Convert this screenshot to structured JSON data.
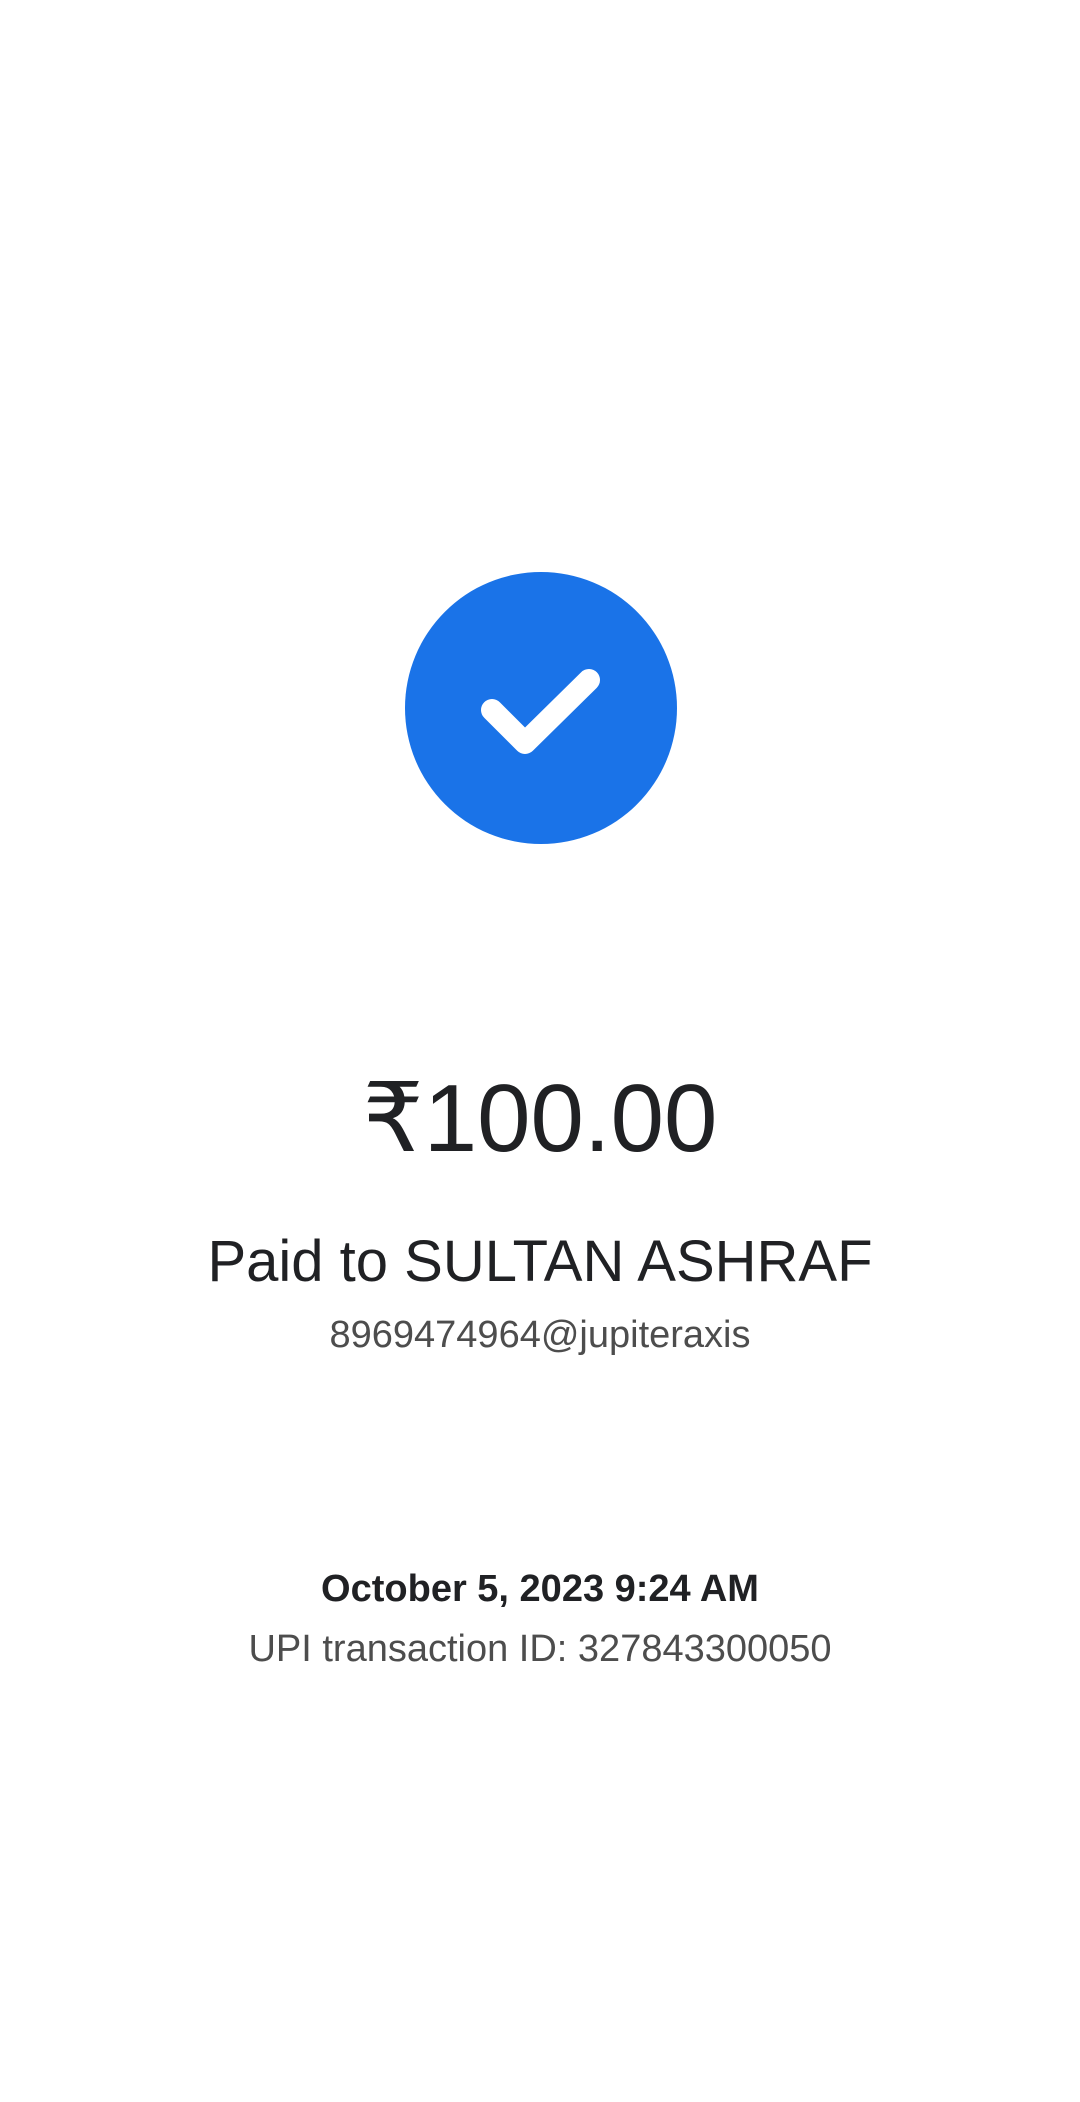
{
  "status": {
    "icon": "check-circle-icon",
    "color": "#1a73e8"
  },
  "payment": {
    "amount": "₹100.00",
    "paid_to": "Paid to SULTAN ASHRAF",
    "upi_id": "8969474964@jupiteraxis"
  },
  "details": {
    "datetime": "October 5, 2023 9:24 AM",
    "transaction_id": "UPI transaction ID: 327843300050"
  }
}
